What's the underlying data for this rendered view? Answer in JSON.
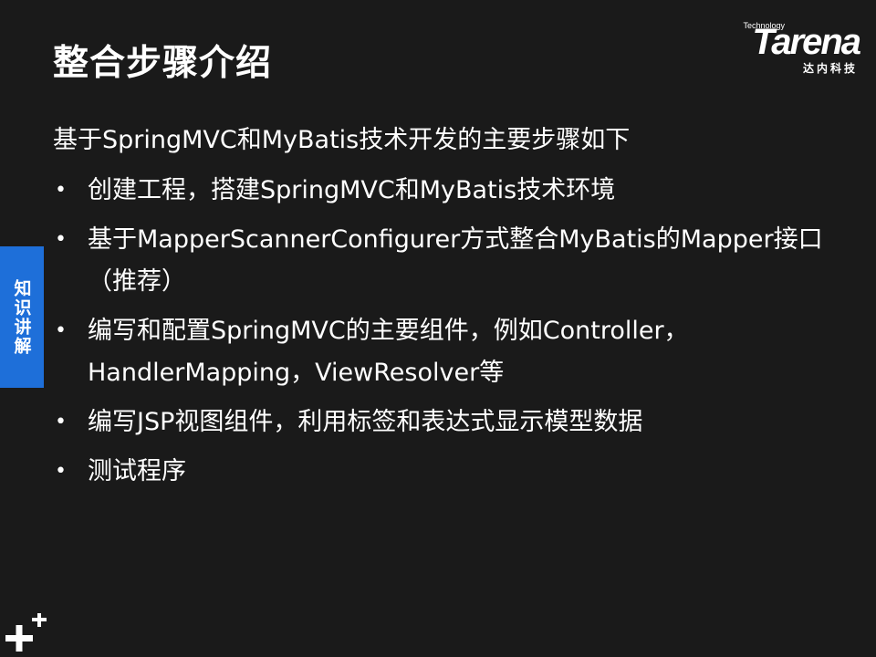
{
  "title": "整合步骤介绍",
  "logo": {
    "technology": "Technology",
    "wordmark": "Tarena",
    "chinese": "达内科技"
  },
  "content": {
    "intro": "基于SpringMVC和MyBatis技术开发的主要步骤如下",
    "bullets": [
      "创建工程，搭建SpringMVC和MyBatis技术环境",
      "基于MapperScannerConfigurer方式整合MyBatis的Mapper接口（推荐）",
      "编写和配置SpringMVC的主要组件，例如Controller，HandlerMapping，ViewResolver等",
      "编写JSP视图组件，利用标签和表达式显示模型数据",
      "测试程序"
    ]
  },
  "side_tab": {
    "label": "知识讲解"
  },
  "colors": {
    "background": "#1a1a1a",
    "side_tab": "#1e6fd9",
    "text": "#ffffff"
  },
  "icons": {
    "bullet": "bullet-dot",
    "corner": "plus-icon"
  }
}
